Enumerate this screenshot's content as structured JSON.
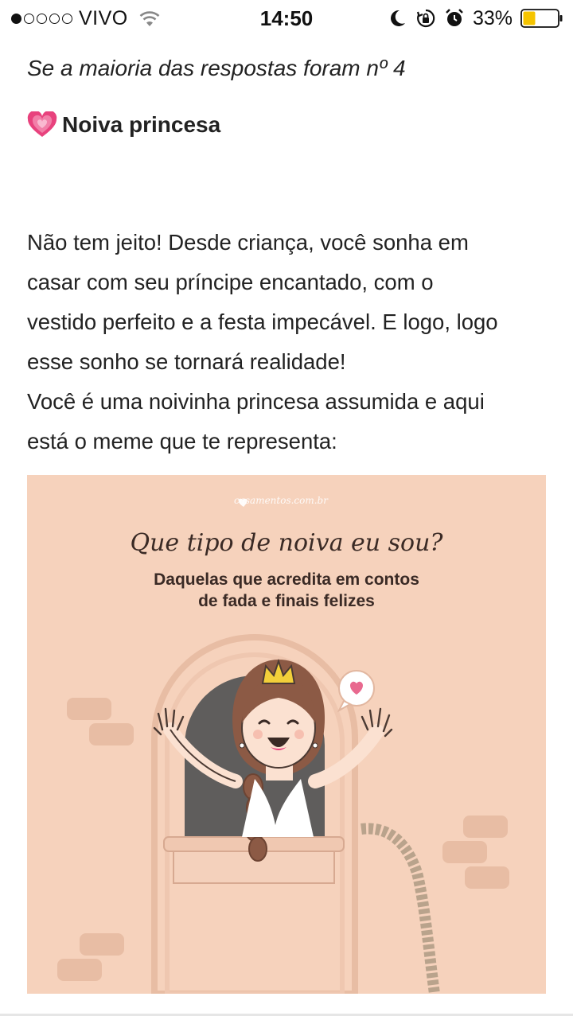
{
  "status_bar": {
    "carrier": "VIVO",
    "time": "14:50",
    "battery": "33%",
    "signal_bars_filled": 1,
    "signal_bars_total": 5,
    "battery_level": 0.33,
    "icons": [
      "wifi-icon",
      "moon-icon",
      "rotation-lock-icon",
      "alarm-icon",
      "battery-icon"
    ]
  },
  "article": {
    "subtitle": "Se a maioria das respostas foram nº 4",
    "heading_emoji": "growing-heart-icon",
    "heading": "Noiva princesa",
    "body_lines": [
      "Não tem jeito! Desde criança, você sonha em",
      "casar com seu príncipe encantado, com o",
      "vestido perfeito e a festa impecável. E logo, logo",
      "esse sonho se tornará realidade!",
      "Você é uma noivinha princesa assumida e aqui",
      "está o meme que te representa:"
    ]
  },
  "meme": {
    "logo": "casamentos.com.br",
    "title": "Que tipo de noiva eu sou?",
    "caption_line1": "Daquelas que acredita em contos",
    "caption_line2": "de fada e finais felizes"
  },
  "colors": {
    "meme_background": "#f6d2bc",
    "accent_pink": "#e8427d",
    "battery_fill": "#f5c400"
  }
}
